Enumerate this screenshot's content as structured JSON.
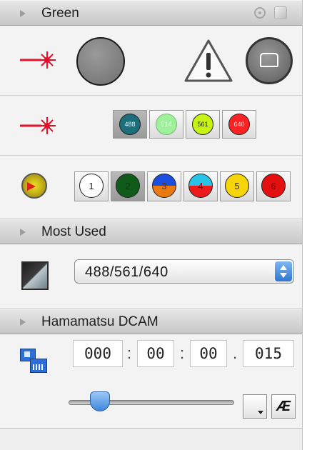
{
  "sections": {
    "green": {
      "title": "Green"
    },
    "most_used": {
      "title": "Most Used"
    },
    "camera": {
      "title": "Hamamatsu DCAM"
    }
  },
  "laser_lines": [
    {
      "label": "488",
      "color": "#1c6f7a",
      "selected": true
    },
    {
      "label": "514",
      "color": "#9ef09b",
      "selected": false
    },
    {
      "label": "561",
      "color": "#c8f414",
      "selected": false
    },
    {
      "label": "640",
      "color": "#ff2222",
      "selected": false
    }
  ],
  "filter_positions": [
    {
      "label": "1",
      "selected": false
    },
    {
      "label": "2",
      "selected": true
    },
    {
      "label": "3",
      "selected": false
    },
    {
      "label": "4",
      "selected": false
    },
    {
      "label": "5",
      "selected": false
    },
    {
      "label": "6",
      "selected": false
    }
  ],
  "preset": {
    "value": "488/561/640"
  },
  "exposure": {
    "field1": "000",
    "field2": "00",
    "field3": "00",
    "field4": "015",
    "sep1": ":",
    "sep2": ":",
    "sep3": "."
  },
  "auto_exposure": {
    "label": "Æ"
  },
  "colors": {
    "laser_red": "#e4102a",
    "warning": "#555555"
  }
}
